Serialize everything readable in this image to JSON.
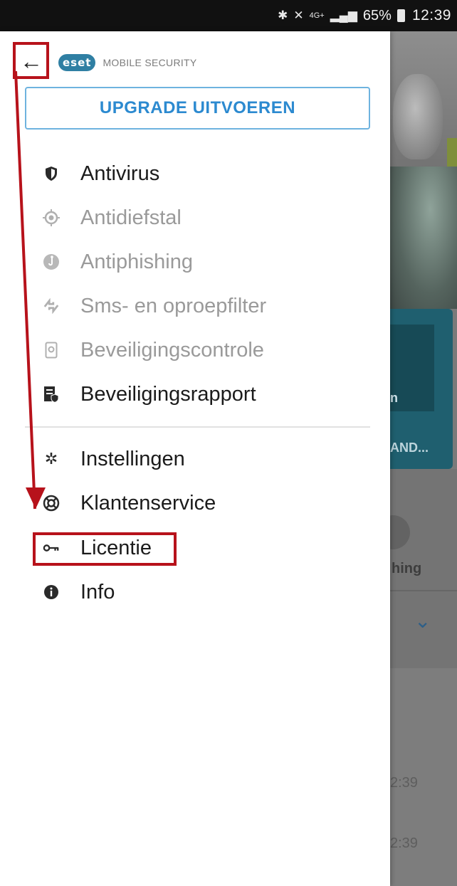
{
  "status_bar": {
    "bluetooth_icon": "bluetooth-icon",
    "mute_icon": "mute-icon",
    "network": "4G+",
    "battery": "65%",
    "time": "12:39"
  },
  "drawer": {
    "back_icon": "back-arrow-icon",
    "logo_badge": "eset",
    "product_name": "MOBILE SECURITY",
    "upgrade_label": "UPGRADE UITVOEREN",
    "items": [
      {
        "label": "Antivirus",
        "icon": "shield-icon",
        "state": "enabled"
      },
      {
        "label": "Antidiefstal",
        "icon": "target-icon",
        "state": "disabled"
      },
      {
        "label": "Antiphishing",
        "icon": "hook-icon",
        "state": "disabled"
      },
      {
        "label": "Sms- en oproepfilter",
        "icon": "call-filter-icon",
        "state": "disabled"
      },
      {
        "label": "Beveiligingscontrole",
        "icon": "phone-check-icon",
        "state": "disabled"
      },
      {
        "label": "Beveiligingsrapport",
        "icon": "report-icon",
        "state": "enabled"
      },
      {
        "label": "Instellingen",
        "icon": "gear-icon",
        "state": "enabled"
      },
      {
        "label": "Klantenservice",
        "icon": "lifebuoy-icon",
        "state": "enabled"
      },
      {
        "label": "Licentie",
        "icon": "key-icon",
        "state": "enabled"
      },
      {
        "label": "Info",
        "icon": "info-icon",
        "state": "enabled"
      }
    ]
  },
  "background_app": {
    "card_text_1": "n",
    "card_text_2": "AND...",
    "feature_text": "hing",
    "time_1": "2:39",
    "time_2": "2:39"
  },
  "colors": {
    "accent_blue": "#2c8ad0",
    "upgrade_border": "#6eb3df",
    "annotation_red": "#b7121b",
    "status_bar": "#111111"
  }
}
